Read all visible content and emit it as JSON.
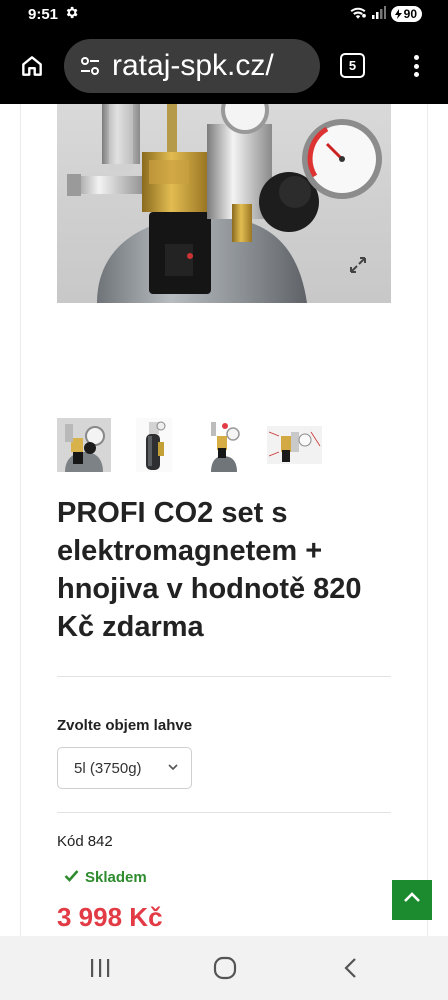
{
  "status_bar": {
    "time": "9:51",
    "battery": "90"
  },
  "browser": {
    "url": "rataj-spk.cz/",
    "tab_count": "5"
  },
  "product": {
    "title": "PROFI CO2 set s elektromagnetem + hnojiva v hodnotě 820 Kč zdarma",
    "variant_label": "Zvolte objem lahve",
    "variant_selected": "5l (3750g)",
    "code_label": "Kód",
    "code_value": "842",
    "stock": "Skladem",
    "price": "3 998 Kč"
  },
  "colors": {
    "price": "#e23b45",
    "stock": "#2e8b2e",
    "scroll_top_bg": "#1c8a2e"
  },
  "icons": {
    "status": [
      "settings-icon",
      "wifi-icon",
      "signal-icon",
      "battery-icon"
    ],
    "browser": [
      "home-icon",
      "site-settings-icon",
      "tabs-icon",
      "more-vert-icon"
    ],
    "page": [
      "expand-icon",
      "check-icon",
      "chevron-up-icon",
      "chevron-down-icon"
    ],
    "nav": [
      "recents-icon",
      "home-circle-icon",
      "back-icon"
    ]
  }
}
